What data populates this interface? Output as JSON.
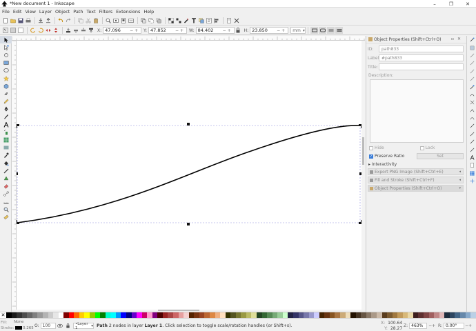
{
  "window": {
    "title": "*New document 1 - Inkscape",
    "controls": [
      "–",
      "❐",
      "✕"
    ]
  },
  "menu": [
    "File",
    "Edit",
    "View",
    "Layer",
    "Object",
    "Path",
    "Text",
    "Filters",
    "Extensions",
    "Help"
  ],
  "toolbar_controls": {
    "x_label": "X:",
    "x_value": "47.096",
    "y_label": "Y:",
    "y_value": "47.852",
    "w_label": "W:",
    "w_value": "84.402",
    "h_label": "H:",
    "h_value": "23.850",
    "unit": "mm"
  },
  "dock": {
    "title": "Object Properties (Shift+Ctrl+O)",
    "id_label": "ID:",
    "id_value": "path833",
    "label_label": "Label:",
    "label_value": "#path833",
    "title_label": "Title:",
    "title_value": "",
    "description_label": "Description:",
    "hide_label": "Hide",
    "lock_label": "Lock",
    "preserve_ratio_label": "Preserve Ratio",
    "set_label": "Set",
    "interactivity_label": "▸ Interactivity",
    "panels": [
      "Export PNG Image (Shift+Ctrl+E)",
      "Fill and Stroke (Shift+Ctrl+F)",
      "Object Properties (Shift+Ctrl+O)"
    ]
  },
  "palette_colors": [
    "#000000",
    "#1a1a1a",
    "#333333",
    "#4d4d4d",
    "#666666",
    "#808080",
    "#999999",
    "#b3b3b3",
    "#cccccc",
    "#e6e6e6",
    "#ffffff",
    "#800000",
    "#ff0000",
    "#ff6600",
    "#ffcc00",
    "#ffff00",
    "#99cc00",
    "#00ff00",
    "#008000",
    "#00ffcc",
    "#00ffff",
    "#0099ff",
    "#0000ff",
    "#000080",
    "#6600cc",
    "#ff00ff",
    "#cc0066",
    "#ff99cc",
    "#800080",
    "#4d0000",
    "#992222",
    "#aa4444",
    "#cc6666",
    "#e6a0a0",
    "#f5d0d0",
    "#552200",
    "#773311",
    "#994422",
    "#bb6633",
    "#dd8844",
    "#f0b080",
    "#ffe0c0",
    "#333300",
    "#555522",
    "#777733",
    "#999944",
    "#bbbb66",
    "#dddd99",
    "#224422",
    "#336633",
    "#558855",
    "#77aa77",
    "#99cc99",
    "#ccffcc",
    "#222244",
    "#333366",
    "#555588",
    "#7777aa",
    "#9999cc",
    "#ccccff",
    "#442200",
    "#663311",
    "#885522",
    "#aa7744",
    "#ccaa77",
    "#eeddbb",
    "#221100",
    "#443322",
    "#665544",
    "#887766",
    "#aa9988",
    "#ccbbaa",
    "#5a3d1e",
    "#7b5a30",
    "#a07840",
    "#c29a5a",
    "#d8b878",
    "#ead8a8",
    "#3d1e1e",
    "#5e3030",
    "#7f4545",
    "#a06060",
    "#c08888",
    "#e0b8b8",
    "#1e2d3d",
    "#2d4560",
    "#446688",
    "#6688aa",
    "#88aacc",
    "#bbd0e6"
  ],
  "status": {
    "fill_label": "Fill:",
    "fill_value": "None",
    "stroke_label": "Stroke:",
    "stroke_width": "0.265",
    "opacity_label": "O:",
    "opacity_value": "100",
    "layer": "•Layer 1",
    "msg_type": "Path",
    "msg_mid": " 2 nodes in layer ",
    "msg_layer": "Layer 1",
    "msg_tail": ". Click selection to toggle scale/rotation handles (or Shift+s).",
    "x_label": "X:",
    "x_value": "100.64",
    "y_label": "Y:",
    "y_value": "28.27",
    "zoom_label": "Z:",
    "zoom_value": "463%",
    "rot_label": "R:",
    "rot_value": "0.00°"
  },
  "colors": {
    "selection_dash": "#8c8cd9",
    "path_stroke": "#000000",
    "accent": "#3b7dd8"
  }
}
